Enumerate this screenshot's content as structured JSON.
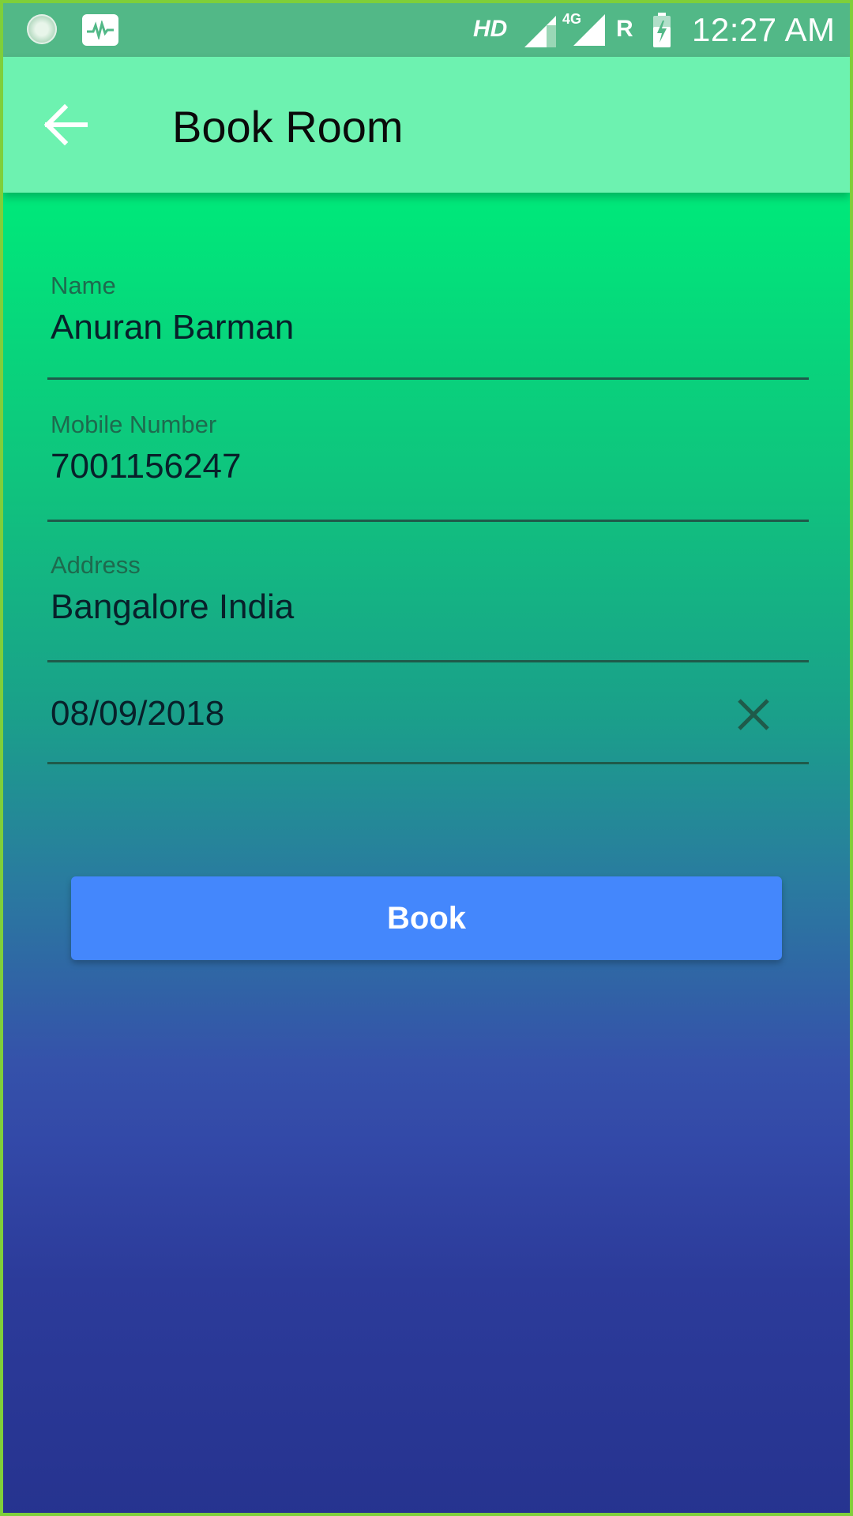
{
  "status_bar": {
    "network_label": "HD",
    "network_type": "4G",
    "roaming": "R",
    "time": "12:27 AM",
    "icons": [
      "loading-circle-icon",
      "activity-monitor-icon",
      "signal-icon",
      "signal-4g-icon",
      "battery-charging-icon"
    ]
  },
  "app_bar": {
    "title": "Book Room",
    "back_icon": "arrow-back-icon"
  },
  "form": {
    "name": {
      "label": "Name",
      "value": "Anuran Barman"
    },
    "mobile": {
      "label": "Mobile Number",
      "value": "7001156247"
    },
    "address": {
      "label": "Address",
      "value": "Bangalore India"
    },
    "date": {
      "value": "08/09/2018",
      "clear_icon": "close-icon"
    }
  },
  "actions": {
    "book_label": "Book"
  },
  "colors": {
    "app_bar": "#6df2b0",
    "status_bar": "#52b887",
    "button": "#4487fc",
    "gradient_top": "#00ea78",
    "gradient_bottom": "#26338f"
  }
}
